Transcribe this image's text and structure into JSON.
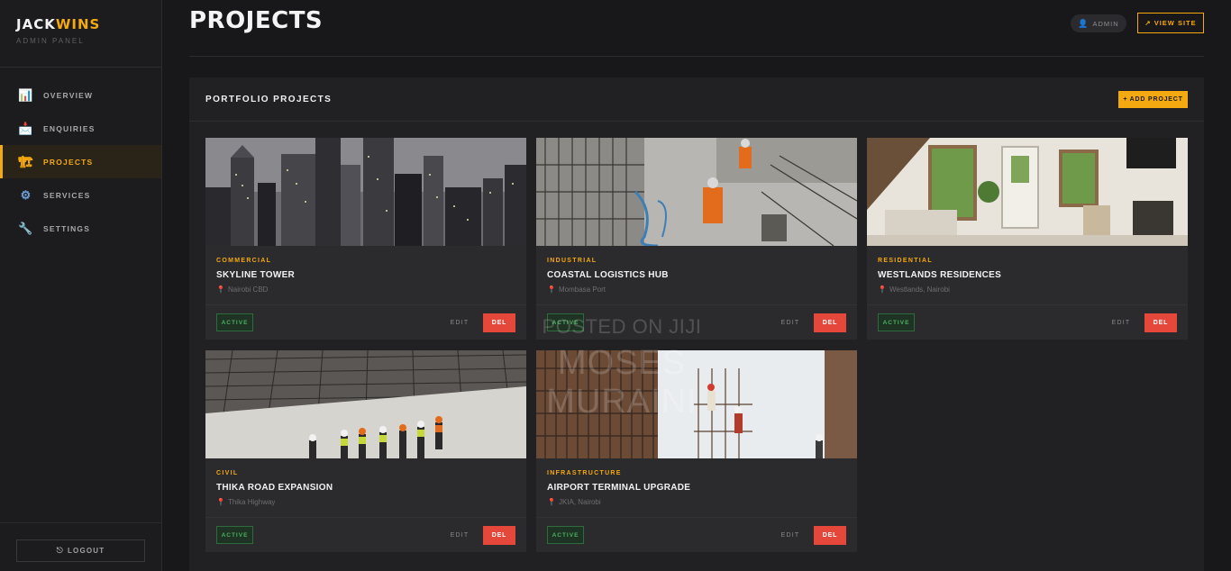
{
  "brand": {
    "name_main": "JACK",
    "name_accent": "WINS",
    "subtitle": "ADMIN PANEL"
  },
  "sidebar": {
    "items": [
      {
        "label": "OVERVIEW",
        "icon": "bar-chart-icon",
        "glyph": "📊"
      },
      {
        "label": "ENQUIRIES",
        "icon": "inbox-icon",
        "glyph": "📩"
      },
      {
        "label": "PROJECTS",
        "icon": "crane-icon",
        "glyph": "🏗",
        "active": true
      },
      {
        "label": "SERVICES",
        "icon": "gear-icon",
        "glyph": "⚙"
      },
      {
        "label": "SETTINGS",
        "icon": "wrench-icon",
        "glyph": "🔧"
      }
    ],
    "logout_label": "LOGOUT",
    "logout_glyph": "⎋"
  },
  "header": {
    "title": "PROJECTS",
    "admin_label": "ADMIN",
    "admin_glyph": "👤",
    "view_site_label": "↗ VIEW SITE"
  },
  "panel": {
    "title": "PORTFOLIO PROJECTS",
    "add_label": "+ ADD PROJECT"
  },
  "projects": [
    {
      "category": "COMMERCIAL",
      "title": "SKYLINE TOWER",
      "location": "Nairobi CBD",
      "status": "ACTIVE",
      "edit": "EDIT",
      "del": "DEL"
    },
    {
      "category": "INDUSTRIAL",
      "title": "COASTAL LOGISTICS HUB",
      "location": "Mombasa Port",
      "status": "ACTIVE",
      "edit": "EDIT",
      "del": "DEL"
    },
    {
      "category": "RESIDENTIAL",
      "title": "WESTLANDS RESIDENCES",
      "location": "Westlands, Nairobi",
      "status": "ACTIVE",
      "edit": "EDIT",
      "del": "DEL"
    },
    {
      "category": "CIVIL",
      "title": "THIKA ROAD EXPANSION",
      "location": "Thika Highway",
      "status": "ACTIVE",
      "edit": "EDIT",
      "del": "DEL"
    },
    {
      "category": "INFRASTRUCTURE",
      "title": "AIRPORT TERMINAL UPGRADE",
      "location": "JKIA, Nairobi",
      "status": "ACTIVE",
      "edit": "EDIT",
      "del": "DEL"
    }
  ],
  "pin_glyph": "📍",
  "watermark": {
    "line1": "POSTED ON JIJI",
    "line2": "MOSES MURAINI"
  },
  "colors": {
    "accent": "#f5a910",
    "danger": "#e5483b",
    "success": "#4caf5f"
  }
}
